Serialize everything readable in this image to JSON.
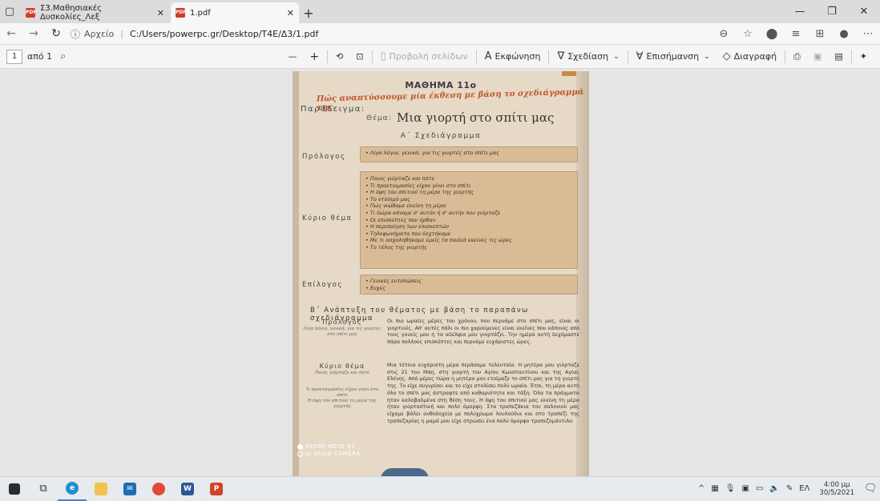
{
  "browser": {
    "tabs": [
      {
        "title": "Σ3.Μαθησιακές Δυσκολίες_Λεξ",
        "active": false
      },
      {
        "title": "1.pdf",
        "active": true
      }
    ],
    "new_tab": "+",
    "url_prefix": "Αρχείο",
    "url_path": "C:/Users/powerpc.gr/Desktop/T4E/Δ3/1.pdf"
  },
  "pdf_toolbar": {
    "page_current": "1",
    "page_of": "από 1",
    "zoom_out": "—",
    "zoom_in": "+",
    "page_view": "Προβολή σελίδων",
    "read_aloud": "Εκφώνηση",
    "draw": "Σχεδίαση",
    "highlight": "Επισήμανση",
    "erase": "Διαγραφή"
  },
  "photo": {
    "title": "ΜΑΘΗΜΑ 11ο",
    "subtitle": "Πώς αναπτύσσουμε μία έκθεση με βάση το σχεδιάγραμμά της",
    "examples": "Παράδειγμα:",
    "theme_label": "Θέμα:",
    "theme_text": "Μια γιορτή στο σπίτι μας",
    "plan_heading": "Α΄ Σχεδιάγραμμα",
    "prologue_label": "Πρόλογος",
    "prologue_items": [
      "Λίγα λόγια, γενικά, για τις γιορτές στο σπίτι μας"
    ],
    "main_label": "Κύριο θέμα",
    "main_items": [
      "Ποιος γιόρταζε και πότε",
      "Τι προετοιμασίες είχαν γίνει στο σπίτι",
      "Η όψη του σπιτιού τη μέρα της γιορτής",
      "Το ντύσιμό μας",
      "Πώς νιώθαμε εκείνη τη μέρα",
      "Τι δώρα κάναμε σ' αυτόν ή σ' αυτήν που γιόρταζε",
      "Οι επισκέπτες που ήρθαν",
      "Η περιποίηση των επισκεπτών",
      "Τηλεφωνήματα που δεχτήκαμε",
      "Με τι ασχοληθήκαμε εμείς τα παιδιά εκείνες τις ώρες",
      "Το τέλος της γιορτής"
    ],
    "epilogue_label": "Επίλογος",
    "epilogue_items": [
      "Γενικές εντυπώσεις",
      "Ευχές"
    ],
    "development_heading": "Β΄ Ανάπτυξη του θέματος με βάση το παραπάνω σχεδιάγραμμα",
    "dev_prologue_head": "Πρόλογος",
    "dev_prologue_note": "Λίγα λόγια, γενικά, για τις γιορτές στο σπίτι μας",
    "dev_prologue_text": "Οι πιο ωραίες μέρες του χρόνου, που περνάμε στο σπίτι μας, είναι οι γιορτινές. Απ' αυτές πάλι οι πιο χαρούμενες είναι εκείνες που κάποιος από τους γονείς μου ή τα αδέλφια μου γιορτάζει. Την ημέρα αυτή δεχόμαστε πάρα πολλούς επισκέπτες και περνάμε ευχάριστες ώρες.",
    "dev_main_head": "Κύριο θέμα",
    "dev_main_note1": "Ποιος γιόρταζε και πότε",
    "dev_main_note2": "Τι προετοιμασίες είχαν γίνει στο σπίτι",
    "dev_main_note3": "Η όψη του σπιτιού τη μέρα της γιορτής",
    "dev_main_text": "Μια τέτοια ευχάριστη μέρα περάσαμε τελευταία. Η μητέρα μου γιόρταζε στις 21 του Μάη, στη γιορτή του Αγίου Κωνσταντίνου και της Αγίας Ελένης. Από μέρες τώρα η μητέρα μου ετοίμαζε το σπίτι μας για τη γιορτή της. Το είχε συγυρίσει και το είχε στολίσει πολύ ωραία. Έτσι, τη μέρα αυτή όλο το σπίτι μας άστραφτε από καθαριότητα και τάξη. Όλα τα πράγματα ήταν καλοβαλμένα στη θέση τους. Η όψη του σπιτιού μας εκείνη τη μέρα ήταν γιορταστική και πολύ όμορφη. Στα τραπεζάκια του σαλονιού μας είχαμε βάλει ανθοδοχεία με πολύχρωμα λουλούδια και στο τραπέζι της τραπεζαρίας η μαμά μου είχε στρώσει ένα πολύ όμορφο τραπεζομάντιλο.",
    "watermark_line1": "REDMI NOTE 8T",
    "watermark_line2": "AI QUAD CAMERA"
  },
  "taskbar": {
    "lang": "ΕΛ",
    "time": "4:00 μμ",
    "date": "30/5/2021"
  }
}
